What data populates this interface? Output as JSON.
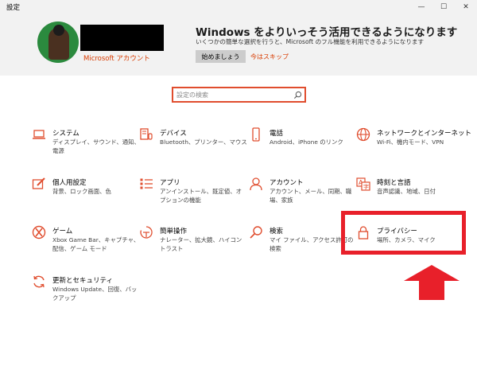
{
  "window": {
    "title": "設定",
    "minimize": "—",
    "maximize": "☐",
    "close": "✕"
  },
  "account": {
    "link_label": "Microsoft アカウント"
  },
  "promo": {
    "title": "Windows をよりいっそう活用できるようになります",
    "description": "いくつかの簡単な選択を行うと、Microsoft のフル機能を利用できるようになります",
    "start_button": "始めましょう",
    "skip_link": "今はスキップ"
  },
  "search": {
    "placeholder": "設定の検索"
  },
  "tiles": [
    {
      "name": "システム",
      "desc": "ディスプレイ、サウンド、通知、電源",
      "icon": "laptop-icon"
    },
    {
      "name": "デバイス",
      "desc": "Bluetooth、プリンター、マウス",
      "icon": "devices-icon"
    },
    {
      "name": "電話",
      "desc": "Android、iPhone のリンク",
      "icon": "phone-icon"
    },
    {
      "name": "ネットワークとインターネット",
      "desc": "Wi-Fi、機内モード、VPN",
      "icon": "globe-icon"
    },
    {
      "name": "個人用設定",
      "desc": "背景、ロック画面、色",
      "icon": "personalization-icon"
    },
    {
      "name": "アプリ",
      "desc": "アンインストール、既定値、オプションの機能",
      "icon": "apps-icon"
    },
    {
      "name": "アカウント",
      "desc": "アカウント、メール、同期、職場、家族",
      "icon": "account-icon"
    },
    {
      "name": "時刻と言語",
      "desc": "音声認識、地域、日付",
      "icon": "time-language-icon"
    },
    {
      "name": "ゲーム",
      "desc": "Xbox Game Bar、キャプチャ、配信、ゲーム モード",
      "icon": "xbox-icon"
    },
    {
      "name": "簡単操作",
      "desc": "ナレーター、拡大鏡、ハイコントラスト",
      "icon": "ease-of-access-icon"
    },
    {
      "name": "検索",
      "desc": "マイ ファイル、アクセス許可の検索",
      "icon": "search-icon"
    },
    {
      "name": "プライバシー",
      "desc": "場所、カメラ、マイク",
      "icon": "lock-icon"
    },
    {
      "name": "更新とセキュリティ",
      "desc": "Windows Update、回復、バックアップ",
      "icon": "update-icon"
    }
  ],
  "colors": {
    "accent": "#e04d2e",
    "highlight": "#e8202a",
    "link": "#d83b01"
  }
}
